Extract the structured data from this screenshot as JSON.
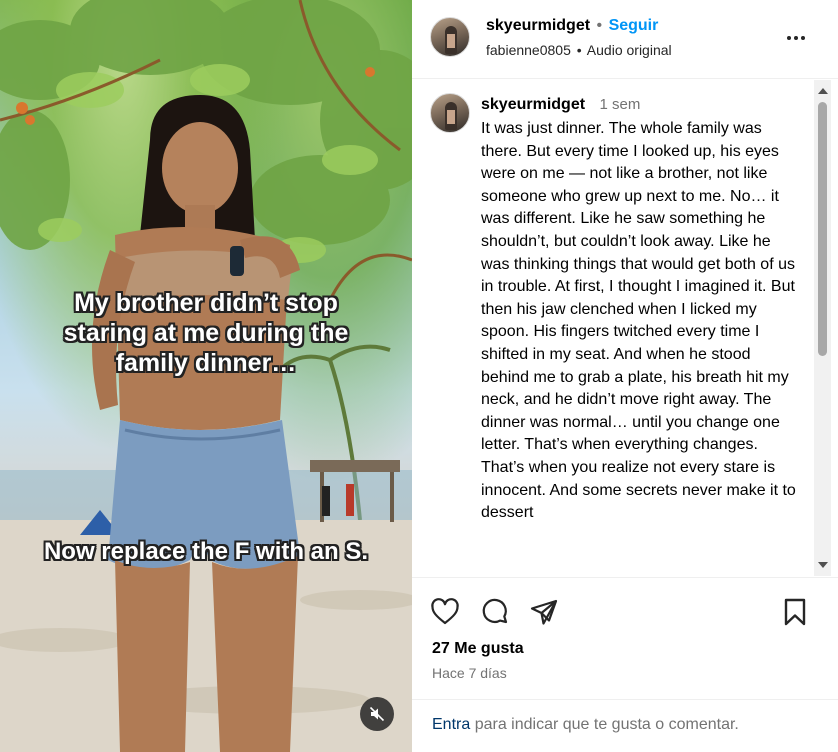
{
  "media": {
    "caption_top": "My brother didn’t stop staring at me during the family dinner…",
    "caption_bottom": "Now replace the F with an S.",
    "mute_icon": "speaker-muted-icon"
  },
  "header": {
    "username": "skyeurmidget",
    "separator": "•",
    "follow_label": "Seguir",
    "audio_user": "fabienne0805",
    "audio_label": "Audio original",
    "more_icon": "more-horizontal-icon"
  },
  "comment": {
    "username": "skyeurmidget",
    "time": "1 sem",
    "text": "It was just dinner. The whole family was there. But every time I looked up, his eyes were on me — not like a brother, not like someone who grew up next to me. No… it was different. Like he saw something he shouldn’t, but couldn’t look away. Like he was thinking things that would get both of us in trouble. At first, I thought I imagined it. But then his jaw clenched when I licked my spoon. His fingers twitched every time I shifted in my seat. And when he stood behind me to grab a plate, his breath hit my neck, and he didn’t move right away. The dinner was normal… until you change one letter. That’s when everything changes. That’s when you realize not every stare is innocent. And some secrets never make it to dessert"
  },
  "actions": {
    "icons": [
      "heart-icon",
      "comment-icon",
      "share-icon",
      "bookmark-icon"
    ],
    "likes": "27 Me gusta",
    "date": "Hace 7 días"
  },
  "footer": {
    "link": "Entra",
    "text": " para indicar que te gusta o comentar."
  }
}
